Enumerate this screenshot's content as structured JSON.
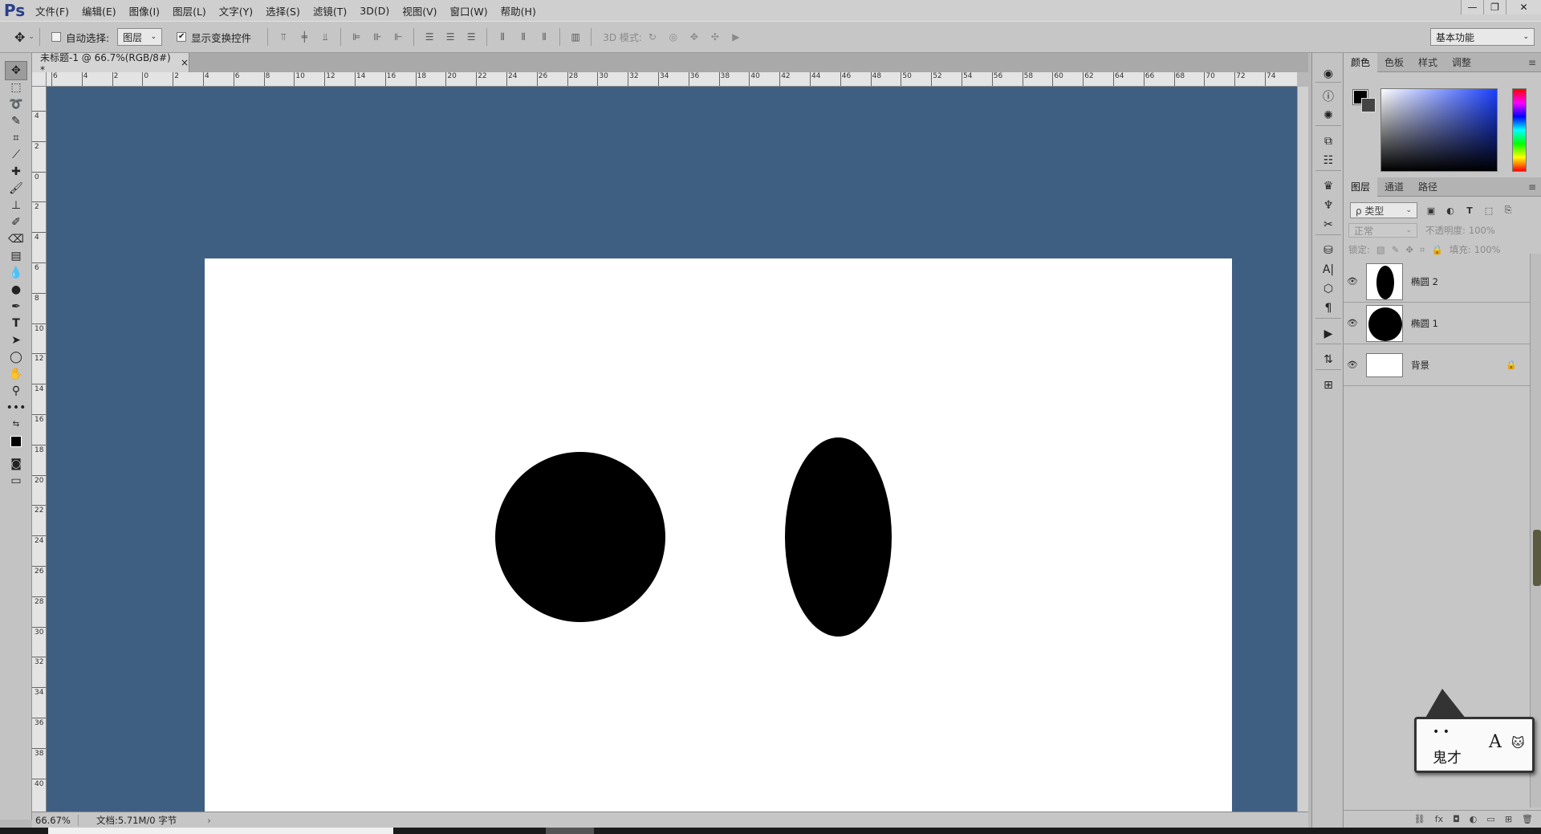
{
  "app": {
    "logo": "Ps"
  },
  "menu": [
    "文件(F)",
    "编辑(E)",
    "图像(I)",
    "图层(L)",
    "文字(Y)",
    "选择(S)",
    "滤镜(T)",
    "3D(D)",
    "视图(V)",
    "窗口(W)",
    "帮助(H)"
  ],
  "window_controls": {
    "minimize": "—",
    "restore": "❐",
    "close": "✕"
  },
  "options": {
    "auto_select_label": "自动选择:",
    "auto_select_checked": false,
    "auto_select_target": "图层",
    "show_transform_label": "显示变换控件",
    "show_transform_checked": true,
    "mode_3d_label": "3D 模式:",
    "workspace": "基本功能"
  },
  "document": {
    "tab_title": "未标题-1 @ 66.7%(RGB/8#) *",
    "tab_close": "×"
  },
  "rulers": {
    "top": [
      "6",
      "4",
      "2",
      "0",
      "2",
      "4",
      "6",
      "8",
      "10",
      "12",
      "14",
      "16",
      "18",
      "20",
      "22",
      "24",
      "26",
      "28",
      "30",
      "32",
      "34",
      "36",
      "38",
      "40",
      "42",
      "44",
      "46",
      "48",
      "50",
      "52",
      "54",
      "56",
      "58",
      "60",
      "62",
      "64",
      "66",
      "68",
      "70",
      "72",
      "74"
    ],
    "left": [
      "4",
      "2",
      "0",
      "2",
      "4",
      "6",
      "8",
      "10",
      "12",
      "14",
      "16",
      "18",
      "20",
      "22",
      "24",
      "26",
      "28",
      "30",
      "32",
      "34",
      "36",
      "38",
      "40"
    ]
  },
  "status": {
    "zoom": "66.67%",
    "doc_info": "文档:5.71M/0 字节",
    "arrow": "›"
  },
  "color_panel": {
    "tabs": [
      "颜色",
      "色板",
      "样式",
      "调整"
    ],
    "active_tab": "颜色",
    "foreground": "#000000",
    "background": "#444444"
  },
  "layers_panel": {
    "tabs": [
      "图层",
      "通道",
      "路径"
    ],
    "active_tab": "图层",
    "filter_kind": "ρ 类型",
    "blend_mode": "正常",
    "opacity_label": "不透明度:",
    "opacity_value": "100%",
    "lock_label": "锁定:",
    "fill_label": "填充:",
    "fill_value": "100%",
    "layers": [
      {
        "name": "椭圆 2",
        "visible": true,
        "locked": false
      },
      {
        "name": "椭圆 1",
        "visible": true,
        "locked": false
      },
      {
        "name": "背景",
        "visible": true,
        "locked": true
      }
    ]
  },
  "canvas": {
    "pasteboard_color": "#3f5f82",
    "document_color": "#ffffff"
  },
  "watermark": {
    "text": "鬼才",
    "letter": "A"
  }
}
